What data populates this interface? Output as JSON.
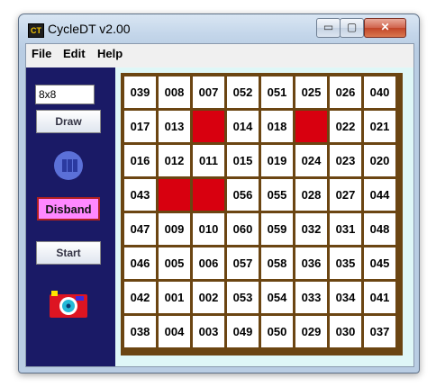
{
  "window": {
    "title": "CycleDT v2.00",
    "icon_text": "CT",
    "minimize": "▭",
    "maximize": "▢",
    "close": "✕"
  },
  "menu": [
    "File",
    "Edit",
    "Help"
  ],
  "controls": {
    "size_value": "8x8",
    "draw_label": "Draw",
    "disband_label": "Disband",
    "start_label": "Start"
  },
  "grid": {
    "rows": [
      [
        "039",
        "008",
        "007",
        "052",
        "051",
        "025",
        "026",
        "040"
      ],
      [
        "017",
        "013",
        "",
        "014",
        "018",
        "",
        "022",
        "021"
      ],
      [
        "016",
        "012",
        "011",
        "015",
        "019",
        "024",
        "023",
        "020"
      ],
      [
        "043",
        "",
        "",
        "056",
        "055",
        "028",
        "027",
        "044"
      ],
      [
        "047",
        "009",
        "010",
        "060",
        "059",
        "032",
        "031",
        "048"
      ],
      [
        "046",
        "005",
        "006",
        "057",
        "058",
        "036",
        "035",
        "045"
      ],
      [
        "042",
        "001",
        "002",
        "053",
        "054",
        "033",
        "034",
        "041"
      ],
      [
        "038",
        "004",
        "003",
        "049",
        "050",
        "029",
        "030",
        "037"
      ]
    ],
    "blocked": [
      [
        1,
        2
      ],
      [
        1,
        5
      ],
      [
        3,
        1
      ],
      [
        3,
        2
      ]
    ]
  },
  "colors": {
    "blocked": "#d8000f",
    "board_border": "#6b4512",
    "panel": "#1a1a66"
  }
}
